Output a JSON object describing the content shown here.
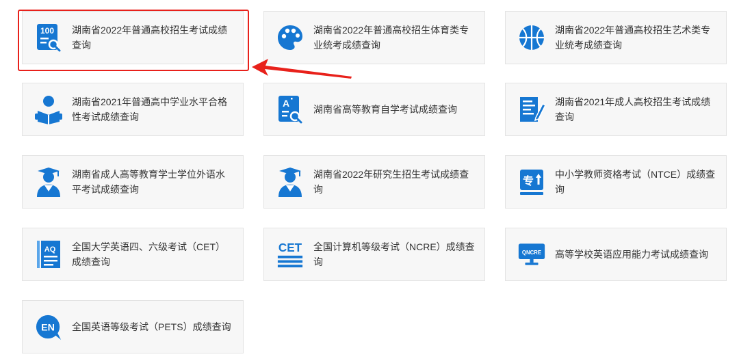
{
  "colors": {
    "icon_blue": "#1677d2",
    "icon_light": "#5aa6ea",
    "annotation_red": "#e8211b"
  },
  "cards": [
    {
      "id": "hn-2022-gaokao",
      "label": "湖南省2022年普通高校招生考试成绩查询",
      "icon": "score-100-icon",
      "icon_text": "100"
    },
    {
      "id": "hn-2022-sports",
      "label": "湖南省2022年普通高校招生体育类专业统考成绩查询",
      "icon": "palette-icon"
    },
    {
      "id": "hn-2022-arts",
      "label": "湖南省2022年普通高校招生艺术类专业统考成绩查询",
      "icon": "basketball-icon"
    },
    {
      "id": "hn-2021-xueye",
      "label": "湖南省2021年普通高中学业水平合格性考试成绩查询",
      "icon": "reader-icon"
    },
    {
      "id": "hn-zixue",
      "label": "湖南省高等教育自学考试成绩查询",
      "icon": "self-study-icon",
      "icon_text": "A"
    },
    {
      "id": "hn-2021-adult",
      "label": "湖南省2021年成人高校招生考试成绩查询",
      "icon": "document-pen-icon"
    },
    {
      "id": "hn-adult-degree-lang",
      "label": "湖南省成人高等教育学士学位外语水平考试成绩查询",
      "icon": "graduate-icon"
    },
    {
      "id": "hn-2022-grad",
      "label": "湖南省2022年研究生招生考试成绩查询",
      "icon": "graduate-icon"
    },
    {
      "id": "ntce",
      "label": "中小学教师资格考试（NTCE）成绩查询",
      "icon": "teacher-cert-icon",
      "icon_text": "专"
    },
    {
      "id": "cet",
      "label": "全国大学英语四、六级考试（CET）成绩查询",
      "icon": "book-aq-icon",
      "icon_text": "AQ"
    },
    {
      "id": "ncre",
      "label": "全国计算机等级考试（NCRE）成绩查询",
      "icon": "cet-icon",
      "icon_text": "CET"
    },
    {
      "id": "pretco",
      "label": "高等学校英语应用能力考试成绩查询",
      "icon": "qncre-monitor-icon",
      "icon_text": "QNCRE"
    },
    {
      "id": "pets",
      "label": "全国英语等级考试（PETS）成绩查询",
      "icon": "en-bubble-icon",
      "icon_text": "EN"
    }
  ]
}
